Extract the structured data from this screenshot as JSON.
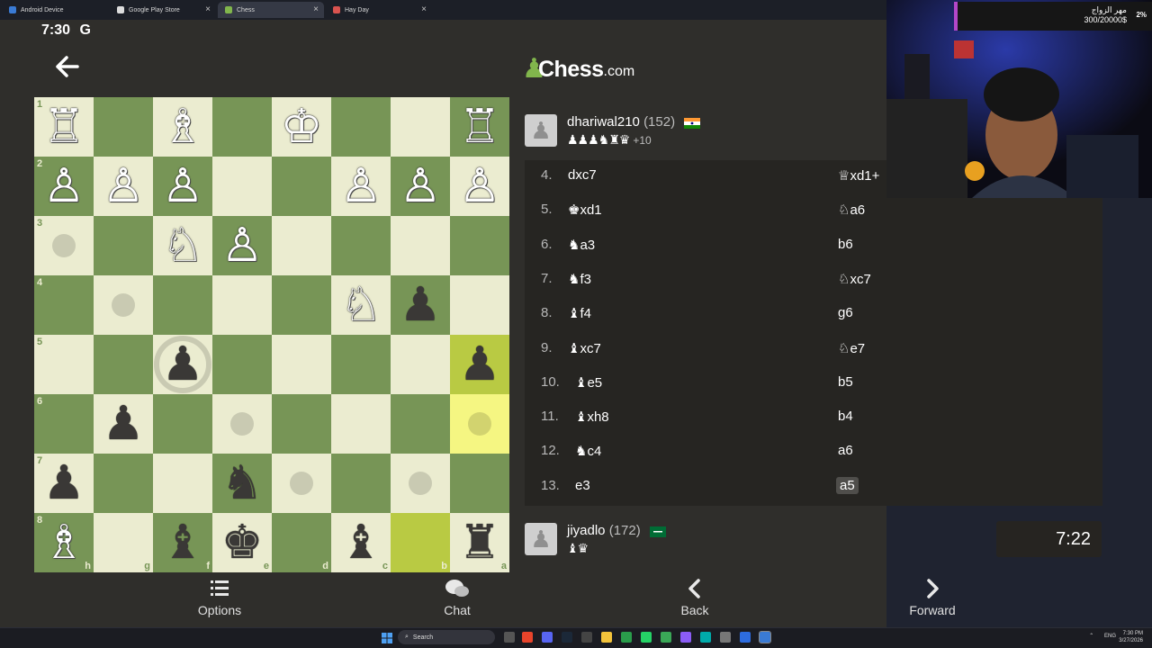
{
  "browser": {
    "tabs": [
      {
        "label": "Android Device",
        "active": false
      },
      {
        "label": "Google Play Store",
        "active": false
      },
      {
        "label": "Chess",
        "active": true
      },
      {
        "label": "Hay Day",
        "active": false
      }
    ]
  },
  "status": {
    "time": "7:30",
    "carrier_icon": "G"
  },
  "header": {
    "logo_text": "Chess",
    "logo_suffix": ".com"
  },
  "board": {
    "ranks": [
      "1",
      "2",
      "3",
      "4",
      "5",
      "6",
      "7",
      "8"
    ],
    "files": [
      "h",
      "g",
      "f",
      "e",
      "d",
      "c",
      "b",
      "a"
    ],
    "squares": [
      [
        "wR",
        "",
        "wB",
        "",
        "wK",
        "",
        "",
        "wR"
      ],
      [
        "wP",
        "wP",
        "wP",
        "",
        "",
        "wP",
        "wP",
        "wP"
      ],
      [
        "hint",
        "",
        "wN",
        "wP",
        "",
        "",
        "",
        ""
      ],
      [
        "",
        "hint",
        "",
        "",
        "",
        "wN",
        "bP",
        ""
      ],
      [
        "",
        "",
        "bP-ring",
        "",
        "",
        "",
        "",
        "bP"
      ],
      [
        "",
        "bP",
        "",
        "hint",
        "",
        "",
        "",
        "hint"
      ],
      [
        "bP",
        "",
        "",
        "bN",
        "hint",
        "",
        "hint",
        ""
      ],
      [
        "wB",
        "",
        "bB",
        "bK",
        "",
        "bB",
        "",
        "bR"
      ]
    ],
    "highlight_squares": [
      "5-7",
      "6-7",
      "8-6"
    ]
  },
  "opponent": {
    "name": "dhariwal210",
    "rating": "(152)",
    "flag": "india-flag",
    "captured": "♟♟♟♞♜♛",
    "advantage": "+10"
  },
  "player": {
    "name": "jiyadlo",
    "rating": "(172)",
    "flag": "saudi-flag",
    "captured": "♝♛",
    "clock": "7:22"
  },
  "moves": [
    {
      "num": "4.",
      "white": "dxc7",
      "black": "♕xd1+"
    },
    {
      "num": "5.",
      "white": "♚xd1",
      "black": "♘a6"
    },
    {
      "num": "6.",
      "white": "♞a3",
      "black": "b6"
    },
    {
      "num": "7.",
      "white": "♞f3",
      "black": "♘xc7"
    },
    {
      "num": "8.",
      "white": "♝f4",
      "black": "g6"
    },
    {
      "num": "9.",
      "white": "♝xc7",
      "black": "♘e7"
    },
    {
      "num": "10.",
      "white": "♝e5",
      "black": "b5"
    },
    {
      "num": "11.",
      "white": "♝xh8",
      "black": "b4"
    },
    {
      "num": "12.",
      "white": "♞c4",
      "black": "a6"
    },
    {
      "num": "13.",
      "white": "e3",
      "black": "a5"
    }
  ],
  "bottom_nav": {
    "options": {
      "label": "Options",
      "icon": "list-icon"
    },
    "chat": {
      "label": "Chat",
      "icon": "chat-icon"
    },
    "back": {
      "label": "Back",
      "icon": "chevron-left-icon"
    },
    "forward": {
      "label": "Forward",
      "icon": "chevron-right-icon"
    }
  },
  "stream_overlay": {
    "title": "مهر الزواج",
    "progress_text": "300/20000$",
    "percent": "2%"
  },
  "taskbar": {
    "search_label": "Search",
    "lang": "ENG",
    "time": "7:30 PM",
    "date": "3/27/2026"
  }
}
